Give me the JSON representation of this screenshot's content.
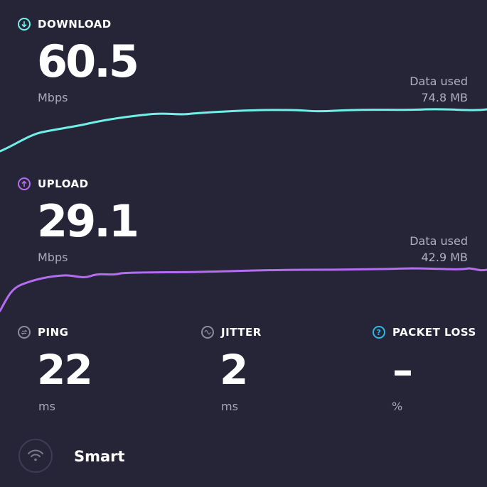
{
  "download": {
    "label": "DOWNLOAD",
    "value": "60.5",
    "unit": "Mbps",
    "data_used_label": "Data used",
    "data_used_value": "74.8 MB",
    "color": "#6ff0e8"
  },
  "upload": {
    "label": "UPLOAD",
    "value": "29.1",
    "unit": "Mbps",
    "data_used_label": "Data used",
    "data_used_value": "42.9 MB",
    "color": "#b46cf0"
  },
  "ping": {
    "label": "PING",
    "value": "22",
    "unit": "ms"
  },
  "jitter": {
    "label": "JITTER",
    "value": "2",
    "unit": "ms"
  },
  "packet_loss": {
    "label": "PACKET LOSS",
    "value": "–",
    "unit": "%"
  },
  "mode": {
    "label": "Smart",
    "icon": "wifi-icon"
  }
}
